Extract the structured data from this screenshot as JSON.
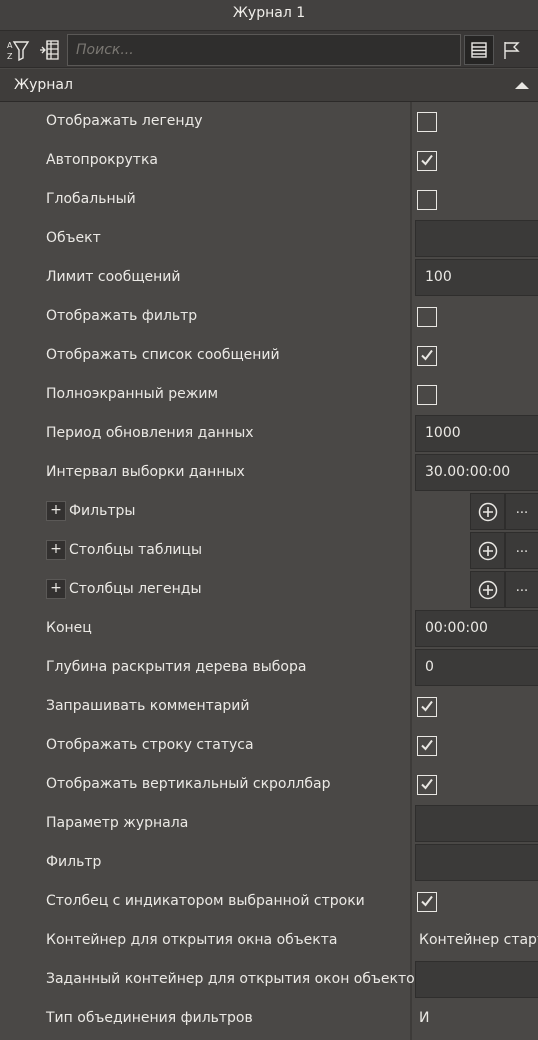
{
  "window": {
    "title": "Журнал 1"
  },
  "toolbar": {
    "search_placeholder": "Поиск..."
  },
  "section": {
    "title": "Журнал"
  },
  "rows": [
    {
      "label": "Отображать легенду",
      "type": "checkbox",
      "checked": false
    },
    {
      "label": "Автопрокрутка",
      "type": "checkbox",
      "checked": true
    },
    {
      "label": "Глобальный",
      "type": "checkbox",
      "checked": false
    },
    {
      "label": "Объект",
      "type": "field",
      "value": ""
    },
    {
      "label": "Лимит сообщений",
      "type": "field",
      "value": "100"
    },
    {
      "label": "Отображать фильтр",
      "type": "checkbox",
      "checked": false
    },
    {
      "label": "Отображать список сообщений",
      "type": "checkbox",
      "checked": true
    },
    {
      "label": "Полноэкранный режим",
      "type": "checkbox",
      "checked": false
    },
    {
      "label": "Период обновления данных",
      "type": "field",
      "value": "1000"
    },
    {
      "label": "Интервал выборки данных",
      "type": "field",
      "value": "30.00:00:00"
    },
    {
      "label": "Фильтры",
      "type": "collection",
      "expander": "+",
      "more": "..."
    },
    {
      "label": "Столбцы таблицы",
      "type": "collection",
      "expander": "+",
      "more": "..."
    },
    {
      "label": "Столбцы легенды",
      "type": "collection",
      "expander": "+",
      "more": "..."
    },
    {
      "label": "Конец",
      "type": "field",
      "value": "00:00:00"
    },
    {
      "label": "Глубина раскрытия дерева выбора",
      "type": "field",
      "value": "0"
    },
    {
      "label": "Запрашивать комментарий",
      "type": "checkbox",
      "checked": true
    },
    {
      "label": "Отображать строку статуса",
      "type": "checkbox",
      "checked": true
    },
    {
      "label": "Отображать вертикальный скроллбар",
      "type": "checkbox",
      "checked": true
    },
    {
      "label": "Параметр журнала",
      "type": "field",
      "value": ""
    },
    {
      "label": "Фильтр",
      "type": "field",
      "value": ""
    },
    {
      "label": "Столбец с индикатором выбранной строки",
      "type": "checkbox",
      "checked": true
    },
    {
      "label": "Контейнер для открытия окна объекта",
      "type": "text",
      "value": "Контейнер старто"
    },
    {
      "label": "Заданный контейнер для открытия окон объектов",
      "type": "field",
      "value": ""
    },
    {
      "label": "Тип объединения фильтров",
      "type": "text",
      "value": "И"
    }
  ]
}
